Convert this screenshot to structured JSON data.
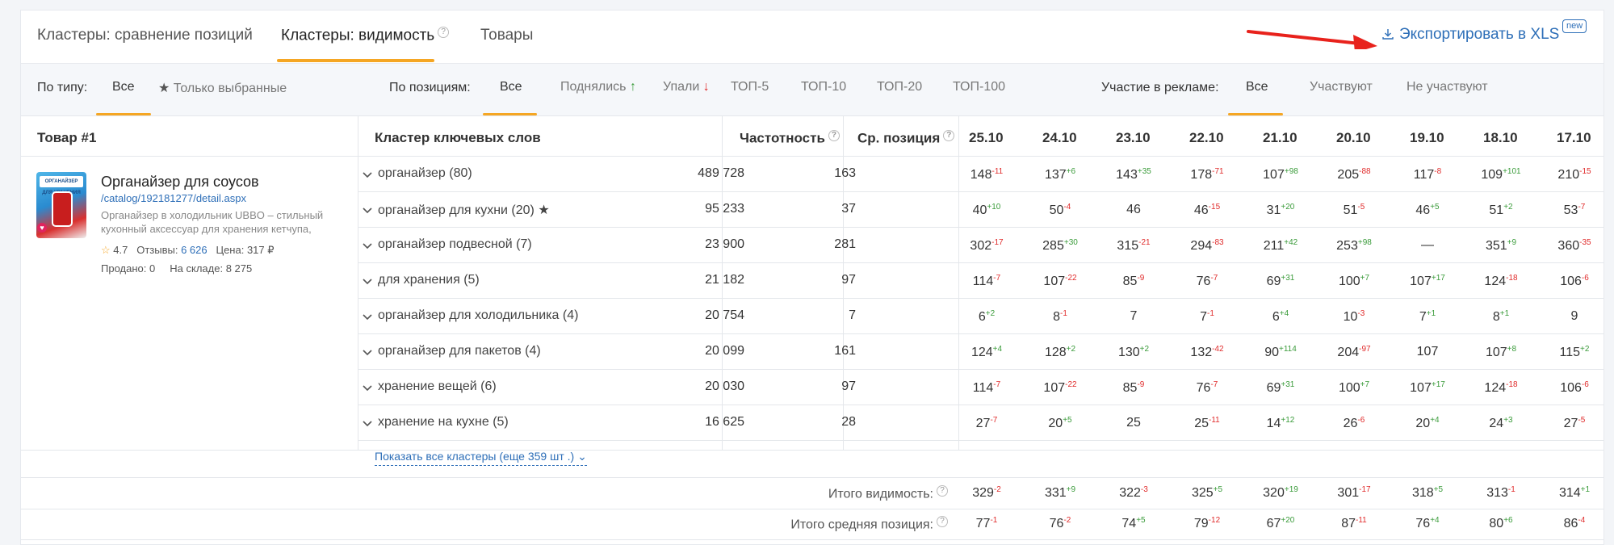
{
  "tabs": [
    {
      "label": "Кластеры: сравнение позиций"
    },
    {
      "label": "Кластеры: видимость",
      "active": true
    },
    {
      "label": "Товары"
    }
  ],
  "export": {
    "label": "Экспортировать в XLS",
    "badge": "new"
  },
  "filters": {
    "type_label": "По типу:",
    "type_options": [
      "Все",
      "Только выбранные"
    ],
    "position_label": "По позициям:",
    "position_options": [
      "Все",
      "Поднялись",
      "Упали",
      "ТОП-5",
      "ТОП-10",
      "ТОП-20",
      "ТОП-100"
    ],
    "ads_label": "Участие в рекламе:",
    "ads_options": [
      "Все",
      "Участвуют",
      "Не участвуют"
    ]
  },
  "columns": {
    "product": "Товар #1",
    "cluster": "Кластер ключевых слов",
    "frequency": "Частотность",
    "avg_position": "Ср. позиция",
    "dates": [
      "25.10",
      "24.10",
      "23.10",
      "22.10",
      "21.10",
      "20.10",
      "19.10",
      "18.10",
      "17.10"
    ]
  },
  "product": {
    "image_label": "ОРГАНАЙЗЕР ДЛЯ ХРАНЕНИЯ",
    "title": "Органайзер для соусов",
    "link": "/catalog/192181277/detail.aspx",
    "description": "Органайзер в холодильник UBBO – стильный кухонный аксессуар для хранения кетчупа,",
    "rating": "4.7",
    "reviews_label": "Отзывы:",
    "reviews": "6 626",
    "price_label": "Цена:",
    "price": "317 ₽",
    "sold_label": "Продано:",
    "sold": "0",
    "stock_label": "На складе:",
    "stock": "8 275"
  },
  "rows": [
    {
      "name": "органайзер (80)",
      "freq": "489 728",
      "pos": "163",
      "cells": [
        [
          "148",
          "-11"
        ],
        [
          "137",
          "+6"
        ],
        [
          "143",
          "+35"
        ],
        [
          "178",
          "-71"
        ],
        [
          "107",
          "+98"
        ],
        [
          "205",
          "-88"
        ],
        [
          "117",
          "-8"
        ],
        [
          "109",
          "+101"
        ],
        [
          "210",
          "-15"
        ]
      ]
    },
    {
      "name": "органайзер для кухни (20) ★",
      "freq": "95 233",
      "pos": "37",
      "cells": [
        [
          "40",
          "+10"
        ],
        [
          "50",
          "-4"
        ],
        [
          "46",
          ""
        ],
        [
          "46",
          "-15"
        ],
        [
          "31",
          "+20"
        ],
        [
          "51",
          "-5"
        ],
        [
          "46",
          "+5"
        ],
        [
          "51",
          "+2"
        ],
        [
          "53",
          "-7"
        ]
      ]
    },
    {
      "name": "органайзер подвесной (7)",
      "freq": "23 900",
      "pos": "281",
      "cells": [
        [
          "302",
          "-17"
        ],
        [
          "285",
          "+30"
        ],
        [
          "315",
          "-21"
        ],
        [
          "294",
          "-83"
        ],
        [
          "211",
          "+42"
        ],
        [
          "253",
          "+98"
        ],
        [
          "—",
          ""
        ],
        [
          "351",
          "+9"
        ],
        [
          "360",
          "-35"
        ]
      ]
    },
    {
      "name": "для хранения (5)",
      "freq": "21 182",
      "pos": "97",
      "cells": [
        [
          "114",
          "-7"
        ],
        [
          "107",
          "-22"
        ],
        [
          "85",
          "-9"
        ],
        [
          "76",
          "-7"
        ],
        [
          "69",
          "+31"
        ],
        [
          "100",
          "+7"
        ],
        [
          "107",
          "+17"
        ],
        [
          "124",
          "-18"
        ],
        [
          "106",
          "-6"
        ]
      ]
    },
    {
      "name": "органайзер для холодильника (4)",
      "freq": "20 754",
      "pos": "7",
      "cells": [
        [
          "6",
          "+2"
        ],
        [
          "8",
          "-1"
        ],
        [
          "7",
          ""
        ],
        [
          "7",
          "-1"
        ],
        [
          "6",
          "+4"
        ],
        [
          "10",
          "-3"
        ],
        [
          "7",
          "+1"
        ],
        [
          "8",
          "+1"
        ],
        [
          "9",
          ""
        ]
      ]
    },
    {
      "name": "органайзер для пакетов (4)",
      "freq": "20 099",
      "pos": "161",
      "cells": [
        [
          "124",
          "+4"
        ],
        [
          "128",
          "+2"
        ],
        [
          "130",
          "+2"
        ],
        [
          "132",
          "-42"
        ],
        [
          "90",
          "+114"
        ],
        [
          "204",
          "-97"
        ],
        [
          "107",
          ""
        ],
        [
          "107",
          "+8"
        ],
        [
          "115",
          "+2"
        ]
      ]
    },
    {
      "name": "хранение вещей (6)",
      "freq": "20 030",
      "pos": "97",
      "cells": [
        [
          "114",
          "-7"
        ],
        [
          "107",
          "-22"
        ],
        [
          "85",
          "-9"
        ],
        [
          "76",
          "-7"
        ],
        [
          "69",
          "+31"
        ],
        [
          "100",
          "+7"
        ],
        [
          "107",
          "+17"
        ],
        [
          "124",
          "-18"
        ],
        [
          "106",
          "-6"
        ]
      ]
    },
    {
      "name": "хранение на кухне (5)",
      "freq": "16 625",
      "pos": "28",
      "cells": [
        [
          "27",
          "-7"
        ],
        [
          "20",
          "+5"
        ],
        [
          "25",
          ""
        ],
        [
          "25",
          "-11"
        ],
        [
          "14",
          "+12"
        ],
        [
          "26",
          "-6"
        ],
        [
          "20",
          "+4"
        ],
        [
          "24",
          "+3"
        ],
        [
          "27",
          "-5"
        ]
      ]
    }
  ],
  "show_all": "Показать все кластеры (еще 359 шт .)",
  "totals": [
    {
      "label": "Итого видимость:",
      "cells": [
        [
          "329",
          "-2"
        ],
        [
          "331",
          "+9"
        ],
        [
          "322",
          "-3"
        ],
        [
          "325",
          "+5"
        ],
        [
          "320",
          "+19"
        ],
        [
          "301",
          "-17"
        ],
        [
          "318",
          "+5"
        ],
        [
          "313",
          "-1"
        ],
        [
          "314",
          "+1"
        ]
      ]
    },
    {
      "label": "Итого средняя позиция:",
      "cells": [
        [
          "77",
          "-1"
        ],
        [
          "76",
          "-2"
        ],
        [
          "74",
          "+5"
        ],
        [
          "79",
          "-12"
        ],
        [
          "67",
          "+20"
        ],
        [
          "87",
          "-11"
        ],
        [
          "76",
          "+4"
        ],
        [
          "80",
          "+6"
        ],
        [
          "86",
          "-4"
        ]
      ]
    }
  ],
  "colors": {
    "accent": "#f5a623",
    "link": "#2e6fb8",
    "up": "#3a9b3a",
    "down": "#e02b2b"
  }
}
